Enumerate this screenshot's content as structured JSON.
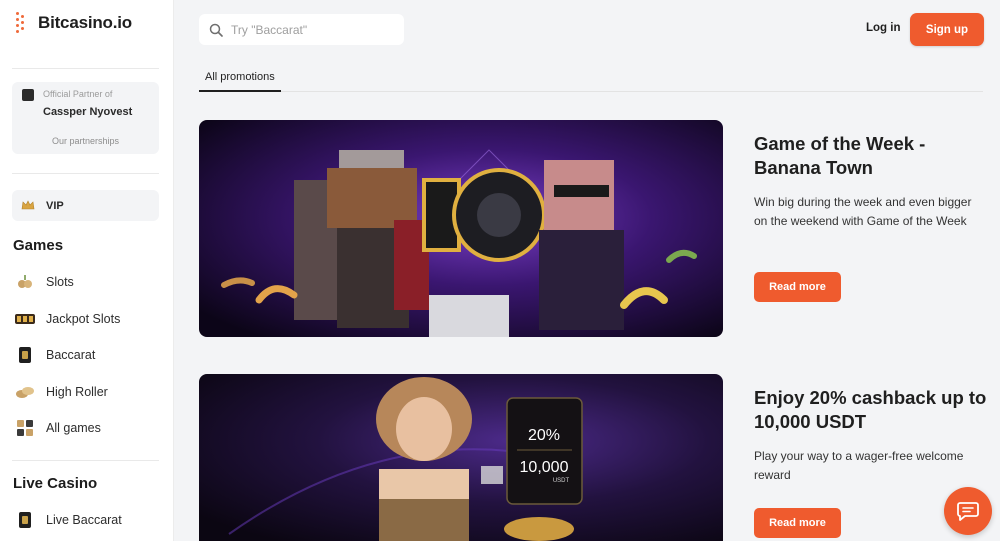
{
  "brand": {
    "name": "Bitcasino.io",
    "accent": "#ef5b2e"
  },
  "sidebar": {
    "partner": {
      "kicker": "Official Partner of",
      "name": "Cassper Nyovest",
      "link": "Our partnerships"
    },
    "vip_label": "VIP",
    "games_title": "Games",
    "games": [
      {
        "label": "Slots",
        "icon": "slots-icon"
      },
      {
        "label": "Jackpot Slots",
        "icon": "jackpot-icon"
      },
      {
        "label": "Baccarat",
        "icon": "baccarat-icon"
      },
      {
        "label": "High Roller",
        "icon": "high-roller-icon"
      },
      {
        "label": "All games",
        "icon": "all-games-icon"
      }
    ],
    "live_title": "Live Casino",
    "live": [
      {
        "label": "Live Baccarat",
        "icon": "live-baccarat-icon"
      }
    ]
  },
  "header": {
    "search_placeholder": "Try \"Baccarat\"",
    "login": "Log in",
    "signup": "Sign up"
  },
  "tabs": {
    "active": "All promotions"
  },
  "promos": [
    {
      "title": "Game of the Week - Banana Town",
      "description": "Win big during the week and even bigger on the weekend with Game of the Week",
      "button": "Read more"
    },
    {
      "title": "Enjoy 20% cashback up to 10,000 USDT",
      "description": "Play your way to a wager-free welcome reward",
      "button": "Read more",
      "banner_text": {
        "percent": "20%",
        "amount": "10,000",
        "currency": "USDT"
      }
    }
  ]
}
